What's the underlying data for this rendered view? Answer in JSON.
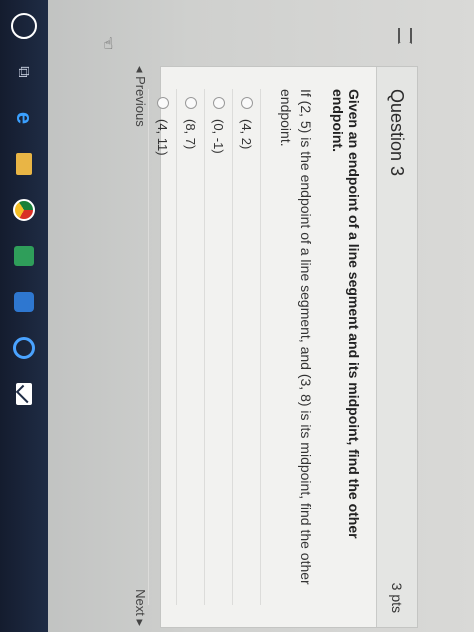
{
  "question": {
    "title": "Question 3",
    "points": "3 pts",
    "prompt": "Given an endpoint of a line segment and its midpoint, find the other endpoint.",
    "text": "If (2, 5) is the endpoint of a line segment, and (3, 8) is its midpoint, find the other endpoint.",
    "options": [
      "(4, 2)",
      "(0, -1)",
      "(8, 7)",
      "(4, 11)"
    ]
  },
  "nav": {
    "previous_label": "◂ Previous",
    "next_label": "Next ▸"
  },
  "icons": {
    "flag": "flag-icon",
    "taskbar": [
      "search-icon",
      "task-view-icon",
      "edge-icon",
      "folder-icon",
      "chrome-icon",
      "app-icon",
      "app-icon",
      "app-icon",
      "mail-icon"
    ]
  },
  "colors": {
    "taskbar": "#1f2c45",
    "card": "#f2f2f0"
  }
}
